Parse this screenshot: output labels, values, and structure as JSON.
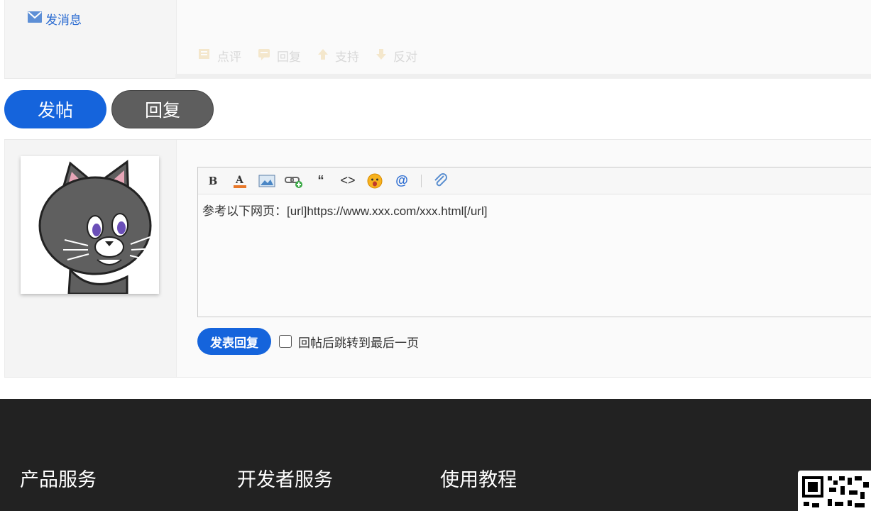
{
  "post_top": {
    "message_link": "发消息",
    "actions": [
      "点评",
      "回复",
      "支持",
      "反对"
    ]
  },
  "buttons": {
    "new_post": "发帖",
    "reply": "回复"
  },
  "editor": {
    "content": "参考以下网页：[url]https://www.xxx.com/xxx.html[/url]",
    "toolbar": [
      "bold-icon",
      "font-color-icon",
      "image-icon",
      "link-icon",
      "quote-icon",
      "code-icon",
      "emoji-icon",
      "mention-icon",
      "attachment-icon"
    ]
  },
  "submit": {
    "label": "发表回复",
    "checkbox_label": "回帖后跳转到最后一页",
    "checked": false
  },
  "footer": {
    "columns": [
      "产品服务",
      "开发者服务",
      "使用教程"
    ]
  },
  "colors": {
    "accent": "#1564dc",
    "footer_bg": "#222222",
    "gray_button": "#5e5e5e"
  }
}
